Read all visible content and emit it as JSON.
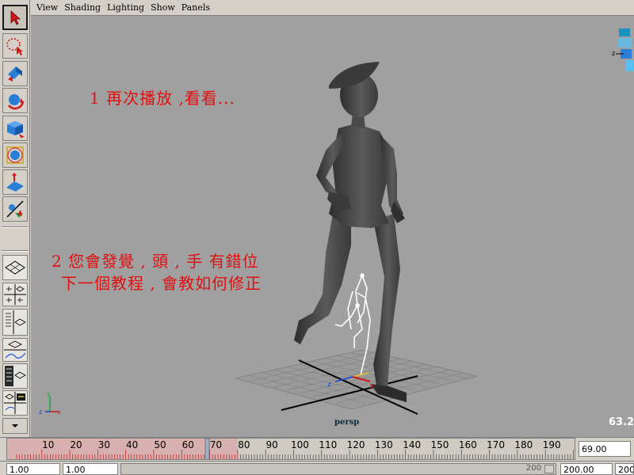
{
  "menubar": {
    "items": [
      "View",
      "Shading",
      "Lighting",
      "Show",
      "Panels"
    ]
  },
  "annotations": {
    "line1": "1 再次播放 ,看看...",
    "line2": "2 您會發覺 , 頭 , 手 有錯位",
    "line3": "下一個教程 , 會教如何修正"
  },
  "viewport": {
    "camera_label": "persp",
    "readout": "63.2"
  },
  "timeline": {
    "ticks": [
      "10",
      "20",
      "30",
      "40",
      "50",
      "60",
      "70",
      "80",
      "90",
      "100",
      "110",
      "120",
      "130",
      "140",
      "150",
      "160",
      "170",
      "180",
      "190",
      "2"
    ],
    "current_frame": "69.00",
    "current_frame_value": 69
  },
  "range": {
    "start_time": "1.00",
    "playback_start": "1.00",
    "slider_value": "200",
    "playback_end": "200.00",
    "end_time": "200.00"
  },
  "colors": {
    "viewport_bg": "#a0a0a0",
    "annotation_red": "#e01010",
    "panel_bg": "#d4d0c8"
  }
}
